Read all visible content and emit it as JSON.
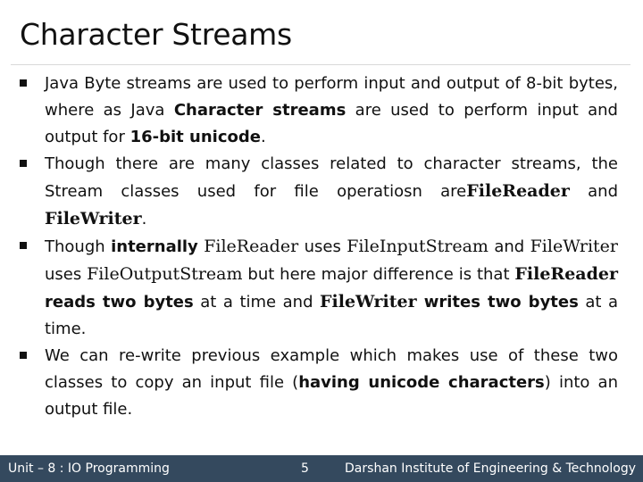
{
  "slide": {
    "title": "Character Streams"
  },
  "bullets": [
    {
      "segments": [
        {
          "text": "Java Byte streams are used to perform input and output of 8-bit bytes, where as Java ",
          "style": "normal"
        },
        {
          "text": "Character streams",
          "style": "bold"
        },
        {
          "text": " are used to perform input and output for ",
          "style": "normal"
        },
        {
          "text": "16-bit unicode",
          "style": "bold"
        },
        {
          "text": ".",
          "style": "normal"
        }
      ]
    },
    {
      "segments": [
        {
          "text": "Though there are many classes related to character streams, the Stream classes used for file operatiosn are",
          "style": "normal"
        },
        {
          "text": "FileReader",
          "style": "serif-bold"
        },
        {
          "text": " and ",
          "style": "normal"
        },
        {
          "text": "FileWriter",
          "style": "serif-bold"
        },
        {
          "text": ".",
          "style": "normal"
        }
      ]
    },
    {
      "segments": [
        {
          "text": "Though ",
          "style": "normal"
        },
        {
          "text": "internally",
          "style": "bold"
        },
        {
          "text": " ",
          "style": "normal"
        },
        {
          "text": "FileReader",
          "style": "serif"
        },
        {
          "text": " uses ",
          "style": "normal"
        },
        {
          "text": "FileInputStream",
          "style": "serif"
        },
        {
          "text": " and ",
          "style": "normal"
        },
        {
          "text": "FileWriter",
          "style": "serif"
        },
        {
          "text": " uses ",
          "style": "normal"
        },
        {
          "text": "FileOutputStream",
          "style": "serif"
        },
        {
          "text": " but here major difference is that ",
          "style": "normal"
        },
        {
          "text": "FileReader",
          "style": "serif-bold"
        },
        {
          "text": " reads two bytes",
          "style": "bold"
        },
        {
          "text": " at a time and ",
          "style": "normal"
        },
        {
          "text": "FileWriter",
          "style": "serif-bold"
        },
        {
          "text": " writes two bytes",
          "style": "bold"
        },
        {
          "text": " at a time.",
          "style": "normal"
        }
      ]
    },
    {
      "segments": [
        {
          "text": "We can re-write previous example which makes use of these two classes to copy an input file (",
          "style": "normal"
        },
        {
          "text": "having unicode characters",
          "style": "bold"
        },
        {
          "text": ") into an output file.",
          "style": "normal"
        }
      ]
    }
  ],
  "footer": {
    "unit": "Unit – 8 : IO Programming",
    "page_number": "5",
    "institute": "Darshan Institute of Engineering & Technology"
  },
  "colors": {
    "footer_background": "#34495e",
    "footer_text": "#ffffff",
    "title_rule": "#d9d9d9"
  }
}
